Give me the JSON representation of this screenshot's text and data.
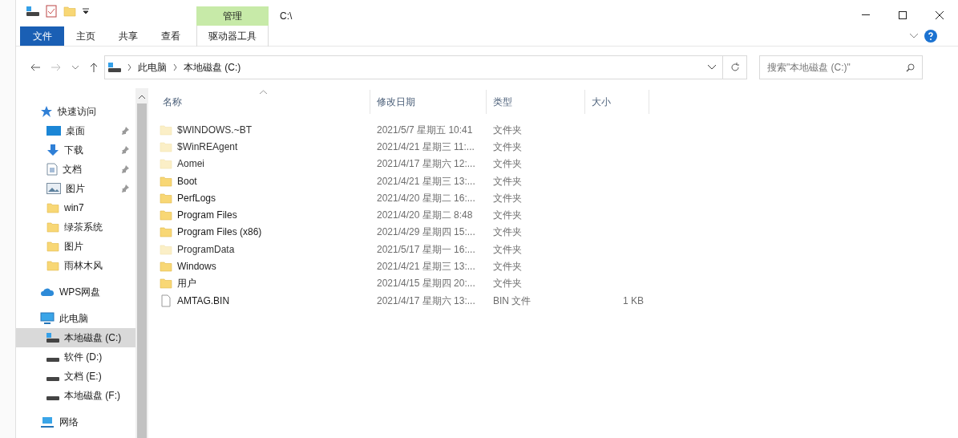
{
  "quick_access_toolbar": {
    "title": "C:\\"
  },
  "context_tab": {
    "group": "管理",
    "label": "驱动器工具"
  },
  "ribbon_tabs": [
    {
      "label": "文件",
      "kind": "file"
    },
    {
      "label": "主页",
      "kind": "tab"
    },
    {
      "label": "共享",
      "kind": "tab"
    },
    {
      "label": "查看",
      "kind": "tab"
    }
  ],
  "address": {
    "crumbs": [
      "此电脑",
      "本地磁盘 (C:)"
    ],
    "search_placeholder": "搜索\"本地磁盘 (C:)\""
  },
  "nav": [
    {
      "label": "快速访问",
      "kind": "star",
      "selected": false,
      "children": [
        {
          "label": "桌面",
          "kind": "desktop",
          "pinned": true,
          "selected": false
        },
        {
          "label": "下载",
          "kind": "download",
          "pinned": true,
          "selected": false
        },
        {
          "label": "文档",
          "kind": "document",
          "pinned": true,
          "selected": false
        },
        {
          "label": "图片",
          "kind": "pictures",
          "pinned": true,
          "selected": false
        },
        {
          "label": "win7",
          "kind": "folder",
          "pinned": false,
          "selected": false
        },
        {
          "label": "绿茶系统",
          "kind": "folder",
          "pinned": false,
          "selected": false
        },
        {
          "label": "图片",
          "kind": "folder",
          "pinned": false,
          "selected": false
        },
        {
          "label": "雨林木风",
          "kind": "folder",
          "pinned": false,
          "selected": false
        }
      ]
    },
    {
      "label": "WPS网盘",
      "kind": "cloud",
      "selected": false
    },
    {
      "label": "此电脑",
      "kind": "pc",
      "selected": false,
      "children": [
        {
          "label": "本地磁盘 (C:)",
          "kind": "windrive",
          "pinned": false,
          "selected": true
        },
        {
          "label": "软件 (D:)",
          "kind": "drive",
          "pinned": false,
          "selected": false
        },
        {
          "label": "文档 (E:)",
          "kind": "drive",
          "pinned": false,
          "selected": false
        },
        {
          "label": "本地磁盘 (F:)",
          "kind": "drive",
          "pinned": false,
          "selected": false
        }
      ]
    },
    {
      "label": "网络",
      "kind": "network",
      "selected": false
    }
  ],
  "table": {
    "columns": [
      "名称",
      "修改日期",
      "类型",
      "大小"
    ],
    "rows": [
      {
        "name": "$WINDOWS.~BT",
        "date": "2021/5/7 星期五 10:41",
        "type": "文件夹",
        "kind": "folder",
        "hidden": true
      },
      {
        "name": "$WinREAgent",
        "date": "2021/4/21 星期三 11:...",
        "type": "文件夹",
        "kind": "folder",
        "hidden": true
      },
      {
        "name": "Aomei",
        "date": "2021/4/17 星期六 12:...",
        "type": "文件夹",
        "kind": "folder",
        "hidden": true
      },
      {
        "name": "Boot",
        "date": "2021/4/21 星期三 13:...",
        "type": "文件夹",
        "kind": "folder",
        "hidden": false
      },
      {
        "name": "PerfLogs",
        "date": "2021/4/20 星期二 16:...",
        "type": "文件夹",
        "kind": "folder",
        "hidden": false
      },
      {
        "name": "Program Files",
        "date": "2021/4/20 星期二 8:48",
        "type": "文件夹",
        "kind": "folder",
        "hidden": false
      },
      {
        "name": "Program Files (x86)",
        "date": "2021/4/29 星期四 15:...",
        "type": "文件夹",
        "kind": "folder",
        "hidden": false
      },
      {
        "name": "ProgramData",
        "date": "2021/5/17 星期一 16:...",
        "type": "文件夹",
        "kind": "folder",
        "hidden": true
      },
      {
        "name": "Windows",
        "date": "2021/4/21 星期三 13:...",
        "type": "文件夹",
        "kind": "folder",
        "hidden": false
      },
      {
        "name": "用户",
        "date": "2021/4/15 星期四 20:...",
        "type": "文件夹",
        "kind": "folder",
        "hidden": false
      },
      {
        "name": "AMTAG.BIN",
        "date": "2021/4/17 星期六 13:...",
        "type": "BIN 文件",
        "size": "1 KB",
        "kind": "file",
        "hidden": false
      }
    ]
  }
}
